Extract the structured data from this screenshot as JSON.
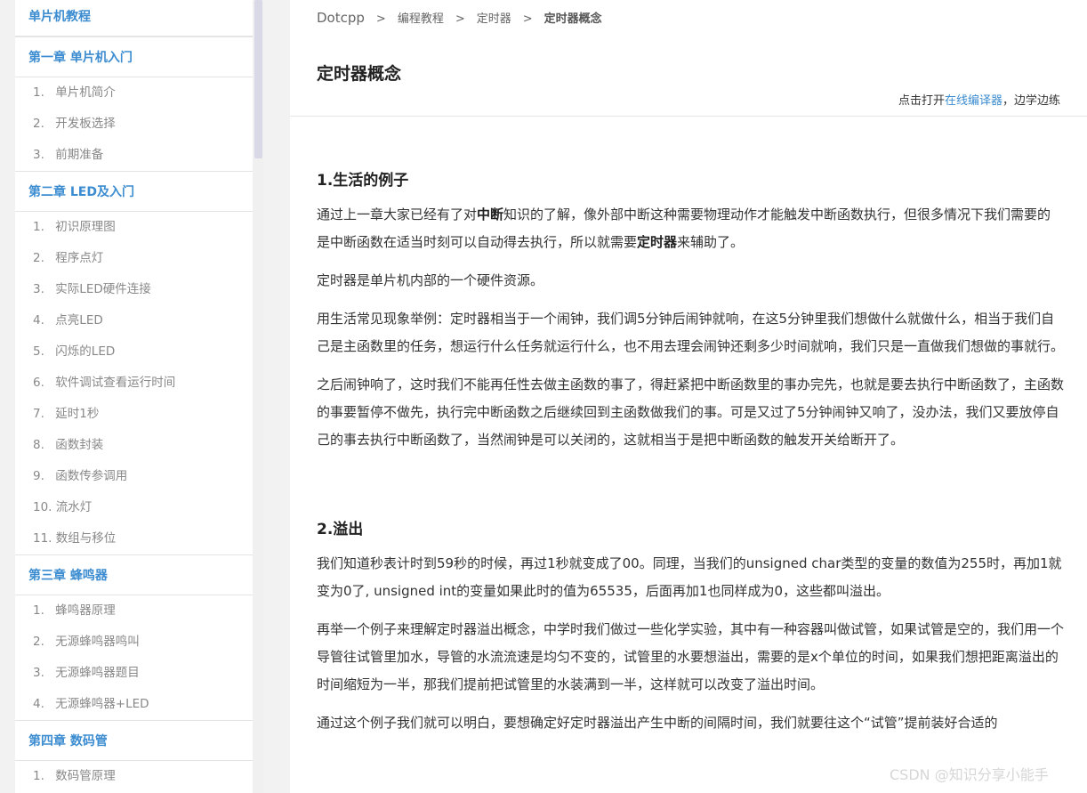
{
  "sidebar": {
    "title": "单片机教程",
    "chapters": [
      {
        "label": "第一章 单片机入门",
        "items": [
          {
            "num": "1.",
            "label": "单片机简介"
          },
          {
            "num": "2.",
            "label": "开发板选择"
          },
          {
            "num": "3.",
            "label": "前期准备"
          }
        ]
      },
      {
        "label": "第二章 LED及入门",
        "items": [
          {
            "num": "1.",
            "label": "初识原理图"
          },
          {
            "num": "2.",
            "label": "程序点灯"
          },
          {
            "num": "3.",
            "label": "实际LED硬件连接"
          },
          {
            "num": "4.",
            "label": "点亮LED"
          },
          {
            "num": "5.",
            "label": "闪烁的LED"
          },
          {
            "num": "6.",
            "label": "软件调试查看运行时间"
          },
          {
            "num": "7.",
            "label": "延时1秒"
          },
          {
            "num": "8.",
            "label": "函数封装"
          },
          {
            "num": "9.",
            "label": "函数传参调用"
          },
          {
            "num": "10.",
            "label": "流水灯"
          },
          {
            "num": "11.",
            "label": "数组与移位"
          }
        ]
      },
      {
        "label": "第三章 蜂鸣器",
        "items": [
          {
            "num": "1.",
            "label": "蜂鸣器原理"
          },
          {
            "num": "2.",
            "label": "无源蜂鸣器鸣叫"
          },
          {
            "num": "3.",
            "label": "无源蜂鸣器题目"
          },
          {
            "num": "4.",
            "label": "无源蜂鸣器+LED"
          }
        ]
      },
      {
        "label": "第四章 数码管",
        "items": [
          {
            "num": "1.",
            "label": "数码管原理"
          }
        ]
      }
    ]
  },
  "breadcrumb": {
    "home": "Dotcpp",
    "sep": ">",
    "level1": "编程教程",
    "level2": "定时器",
    "current": "定时器概念"
  },
  "page": {
    "title": "定时器概念",
    "compiler_prefix": "点击打开",
    "compiler_link": "在线编译器",
    "compiler_suffix": "，边学边练"
  },
  "article": {
    "s1_heading": "1.生活的例子",
    "s1_p1_a": "通过上一章大家已经有了对",
    "s1_p1_b": "中断",
    "s1_p1_c": "知识的了解，像外部中断这种需要物理动作才能触发中断函数执行，但很多情况下我们需要的是中断函数在适当时刻可以自动得去执行，所以就需要",
    "s1_p1_d": "定时器",
    "s1_p1_e": "来辅助了。",
    "s1_p2": "定时器是单片机内部的一个硬件资源。",
    "s1_p3": "用生活常见现象举例：定时器相当于一个闹钟，我们调5分钟后闹钟就响，在这5分钟里我们想做什么就做什么，相当于我们自己是主函数里的任务，想运行什么任务就运行什么，也不用去理会闹钟还剩多少时间就响，我们只是一直做我们想做的事就行。",
    "s1_p4": "之后闹钟响了，这时我们不能再任性去做主函数的事了，得赶紧把中断函数里的事办完先，也就是要去执行中断函数了，主函数的事要暂停不做先，执行完中断函数之后继续回到主函数做我们的事。可是又过了5分钟闹钟又响了，没办法，我们又要放停自己的事去执行中断函数了，当然闹钟是可以关闭的，这就相当于是把中断函数的触发开关给断开了。",
    "s2_heading": "2.溢出",
    "s2_p1": "我们知道秒表计时到59秒的时候，再过1秒就变成了00。同理，当我们的unsigned char类型的变量的数值为255时，再加1就变为0了, unsigned int的变量如果此时的值为65535，后面再加1也同样成为0，这些都叫溢出。",
    "s2_p2": "再举一个例子来理解定时器溢出概念，中学时我们做过一些化学实验，其中有一种容器叫做试管，如果试管是空的，我们用一个导管往试管里加水，导管的水流流速是均匀不变的，试管里的水要想溢出，需要的是x个单位的时间，如果我们想把距离溢出的时间缩短为一半，那我们提前把试管里的水装满到一半，这样就可以改变了溢出时间。",
    "s2_p3": "通过这个例子我们就可以明白，要想确定好定时器溢出产生中断的间隔时间，我们就要往这个“试管”提前装好合适的"
  },
  "watermark": "CSDN @知识分享小能手"
}
